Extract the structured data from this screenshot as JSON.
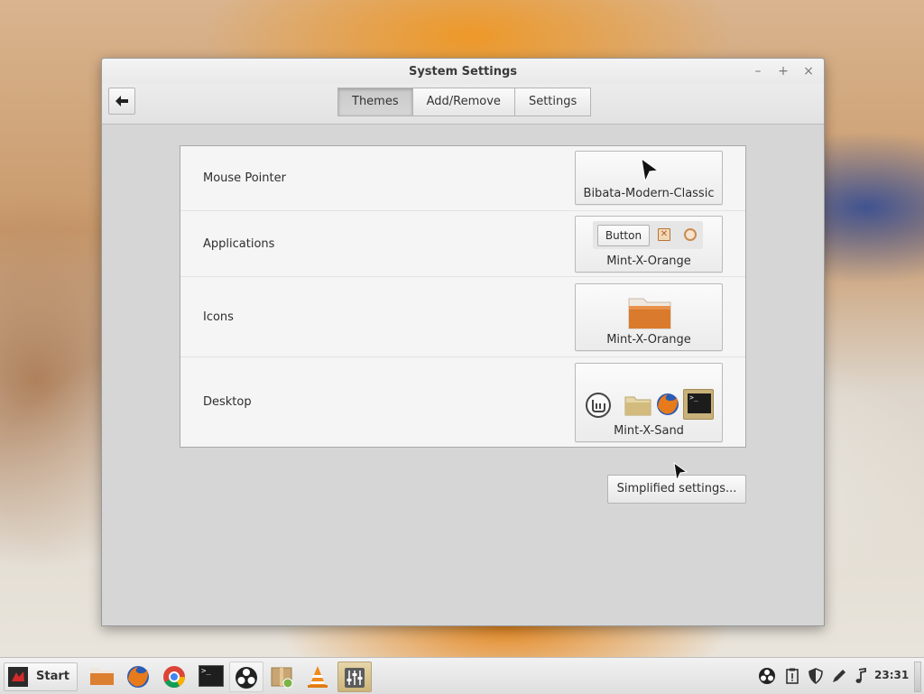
{
  "window": {
    "title": "System Settings",
    "controls": {
      "minimize": "–",
      "maximize": "+",
      "close": "×"
    }
  },
  "toolbar": {
    "back_icon": "arrow-left-icon",
    "tabs": [
      {
        "label": "Themes",
        "active": true
      },
      {
        "label": "Add/Remove",
        "active": false
      },
      {
        "label": "Settings",
        "active": false
      }
    ]
  },
  "themes": {
    "rows": [
      {
        "label": "Mouse Pointer",
        "theme": "Bibata-Modern-Classic",
        "preview": "cursor-icon"
      },
      {
        "label": "Applications",
        "theme": "Mint-X-Orange",
        "preview_button": "Button"
      },
      {
        "label": "Icons",
        "theme": "Mint-X-Orange",
        "preview": "folder-icon"
      },
      {
        "label": "Desktop",
        "theme": "Mint-X-Sand",
        "preview": [
          "mint-logo-icon",
          "folder-icon",
          "firefox-icon",
          "terminal-icon"
        ]
      }
    ],
    "simplified_label": "Simplified settings..."
  },
  "taskbar": {
    "start_label": "Start",
    "launchers": [
      "file-manager-icon",
      "firefox-icon",
      "chrome-icon",
      "terminal-icon",
      "obs-icon",
      "package-manager-icon",
      "vlc-icon",
      "settings-icon"
    ],
    "tray": [
      "obs-tray-icon",
      "clipboard-icon",
      "shield-icon",
      "pen-icon",
      "music-note-icon"
    ],
    "clock": "23:31"
  },
  "colors": {
    "accent_orange": "#e07a22",
    "sand": "#c9a24a",
    "panel": "#f5f5f5",
    "window_bg": "#d6d6d6"
  }
}
